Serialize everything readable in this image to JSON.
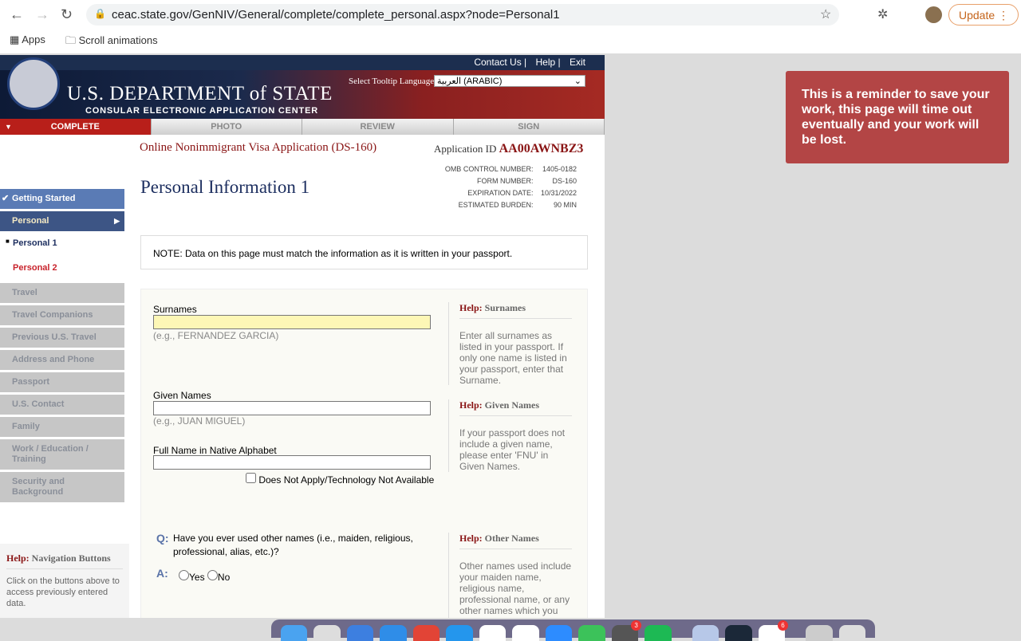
{
  "browser": {
    "url": "ceac.state.gov/GenNIV/General/complete/complete_personal.aspx?node=Personal1",
    "update": "Update",
    "bookmarks": [
      "Apps",
      "Scroll animations"
    ]
  },
  "header": {
    "links": [
      "Contact Us",
      "Help",
      "Exit"
    ],
    "dept": "U.S. DEPARTMENT of STATE",
    "center": "CONSULAR ELECTRONIC APPLICATION CENTER",
    "tooltip_label": "Select Tooltip Language",
    "tooltip_value": "العربية (ARABIC)"
  },
  "tabs": [
    "COMPLETE",
    "PHOTO",
    "REVIEW",
    "SIGN"
  ],
  "form": {
    "title": "Online Nonimmigrant Visa Application (DS-160)",
    "app_id_label": "Application ID",
    "app_id": "AA00AWNBZ3",
    "meta": [
      [
        "OMB CONTROL NUMBER:",
        "1405-0182"
      ],
      [
        "FORM NUMBER:",
        "DS-160"
      ],
      [
        "EXPIRATION DATE:",
        "10/31/2022"
      ],
      [
        "ESTIMATED BURDEN:",
        "90 MIN"
      ]
    ],
    "page_title": "Personal Information 1",
    "note": "NOTE: Data on this page must match the information as it is written in your passport.",
    "surnames": "Surnames",
    "surnames_ex": "(e.g., FERNANDEZ GARCIA)",
    "given": "Given Names",
    "given_ex": "(e.g., JUAN MIGUEL)",
    "native": "Full Name in Native Alphabet",
    "dna": "Does Not Apply/Technology Not Available",
    "q": "Q:",
    "question": "Have you ever used other names (i.e., maiden, religious, professional, alias, etc.)?",
    "a": "A:",
    "yes": "Yes",
    "no": "No"
  },
  "help": [
    {
      "k": "Help:",
      "t": "Surnames",
      "b": "Enter all surnames as listed in your passport. If only one name is listed in your passport, enter that Surname."
    },
    {
      "k": "Help:",
      "t": "Given Names",
      "b": "If your passport does not include a given name, please enter 'FNU' in Given Names."
    },
    {
      "k": "Help:",
      "t": "Other Names",
      "b": "Other names used include your maiden name, religious name, professional name, or any other names which you are known by or"
    },
    {
      "k": "Help:",
      "t": "Navigation Buttons",
      "b": "Click on the buttons above to access previously entered data."
    }
  ],
  "sidebar": [
    "Getting Started",
    "Personal",
    "Personal 1",
    "Personal 2",
    "Travel",
    "Travel Companions",
    "Previous U.S. Travel",
    "Address and Phone",
    "Passport",
    "U.S. Contact",
    "Family",
    "Work / Education / Training",
    "Security and Background"
  ],
  "toast": "This is a reminder to save your work, this page will time out eventually and your work will be lost.",
  "dock_badges": [
    "3",
    "6"
  ]
}
